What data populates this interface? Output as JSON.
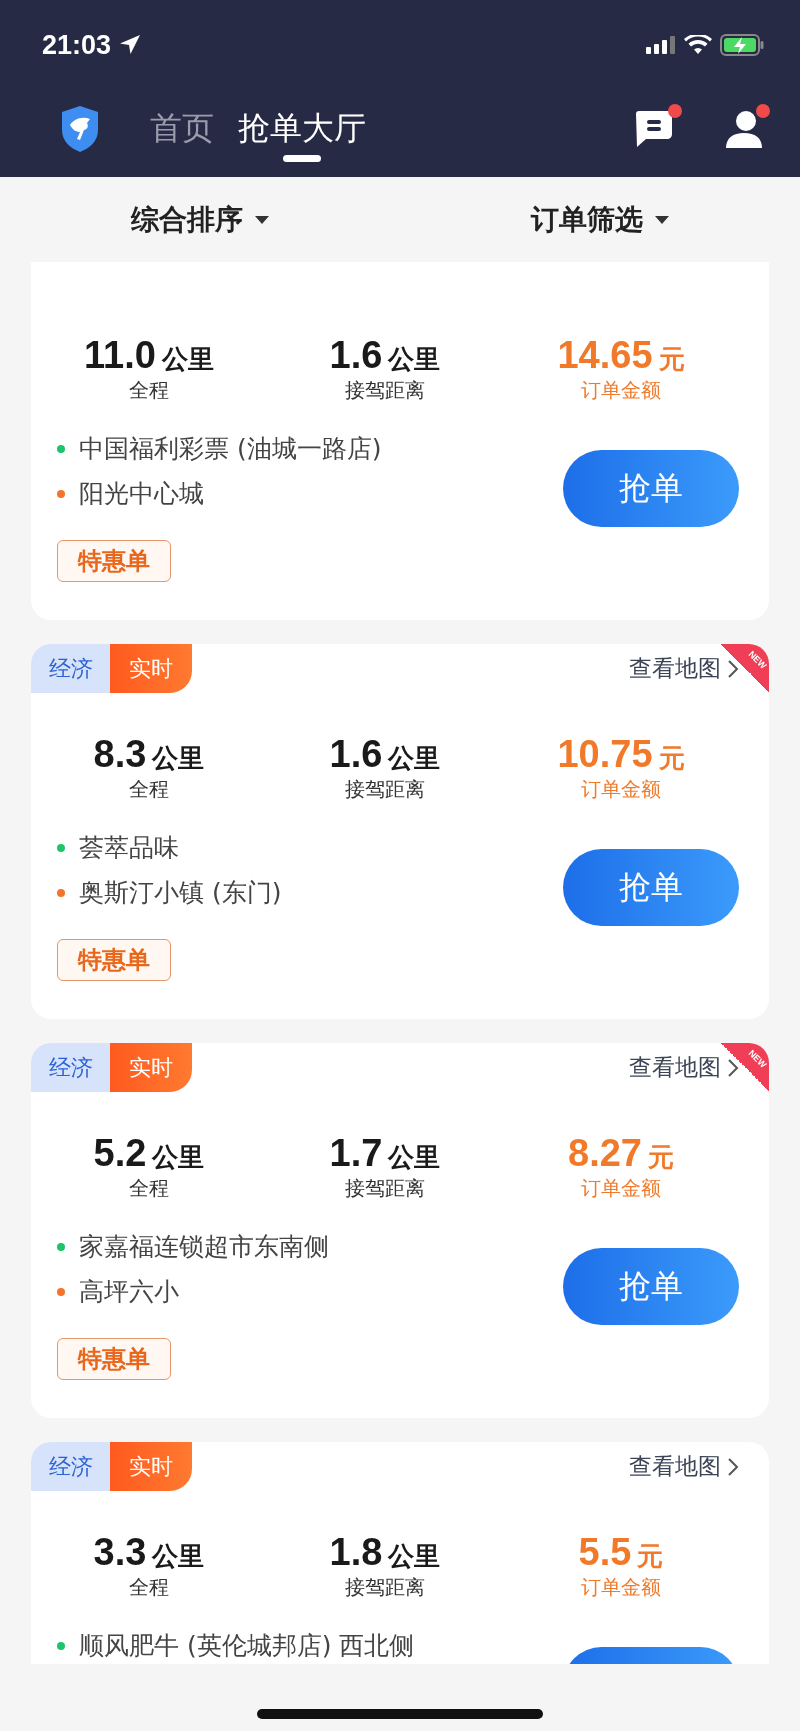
{
  "status_bar": {
    "time": "21:03"
  },
  "nav": {
    "tabs": [
      {
        "label": "首页",
        "selected": false
      },
      {
        "label": "抢单大厅",
        "selected": true
      }
    ],
    "message_unread": true,
    "profile_unread": true
  },
  "filters": [
    {
      "label": "综合排序"
    },
    {
      "label": "订单筛选"
    }
  ],
  "orders": [
    {
      "distance": "11.0",
      "pickup": "1.6",
      "price": "14.65",
      "distance_unit": "公里",
      "distance_label": "全程",
      "pickup_unit": "公里",
      "pickup_label": "接驾距离",
      "price_unit": "元",
      "price_label": "订单金额",
      "from": "中国福利彩票 (油城一路店)",
      "to": "阳光中心城",
      "tag": "特惠单",
      "button": "抢单"
    },
    {
      "type": "经济",
      "mode": "实时",
      "map_link": "查看地图",
      "ribbon": "NEW",
      "distance": "8.3",
      "pickup": "1.6",
      "price": "10.75",
      "distance_unit": "公里",
      "distance_label": "全程",
      "pickup_unit": "公里",
      "pickup_label": "接驾距离",
      "price_unit": "元",
      "price_label": "订单金额",
      "from": "荟萃品味",
      "to": "奥斯汀小镇 (东门)",
      "tag": "特惠单",
      "button": "抢单"
    },
    {
      "type": "经济",
      "mode": "实时",
      "map_link": "查看地图",
      "ribbon": "NEW",
      "distance": "5.2",
      "pickup": "1.7",
      "price": "8.27",
      "distance_unit": "公里",
      "distance_label": "全程",
      "pickup_unit": "公里",
      "pickup_label": "接驾距离",
      "price_unit": "元",
      "price_label": "订单金额",
      "from": "家嘉福连锁超市东南侧",
      "to": "高坪六小",
      "tag": "特惠单",
      "button": "抢单"
    },
    {
      "type": "经济",
      "mode": "实时",
      "map_link": "查看地图",
      "distance": "3.3",
      "pickup": "1.8",
      "price": "5.5",
      "distance_unit": "公里",
      "distance_label": "全程",
      "pickup_unit": "公里",
      "pickup_label": "接驾距离",
      "price_unit": "元",
      "price_label": "订单金额",
      "from": "顺风肥牛 (英伦城邦店) 西北侧"
    }
  ]
}
